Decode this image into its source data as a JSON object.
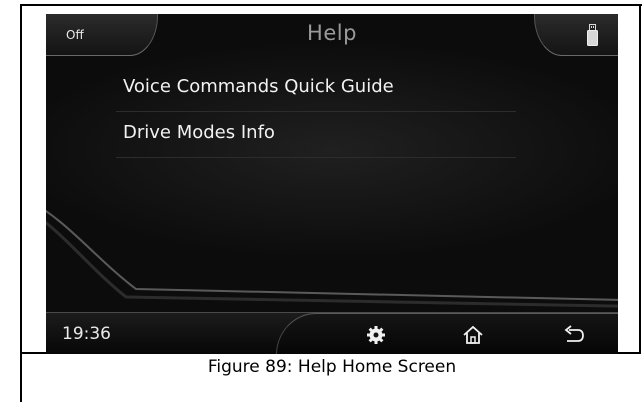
{
  "header": {
    "off_label": "Off",
    "title": "Help",
    "usb_icon": "usb-drive-icon"
  },
  "menu": {
    "items": [
      {
        "label": "Voice Commands Quick Guide"
      },
      {
        "label": "Drive Modes Info"
      }
    ]
  },
  "bottom_bar": {
    "time": "19:36",
    "icons": [
      "settings-gear-icon",
      "home-icon",
      "back-arrow-icon"
    ]
  },
  "caption": "Figure 89: Help Home Screen",
  "colors": {
    "screen_background": "#0b0b0b",
    "title_text": "#9a9a9a",
    "menu_text": "#f2f2f2"
  }
}
